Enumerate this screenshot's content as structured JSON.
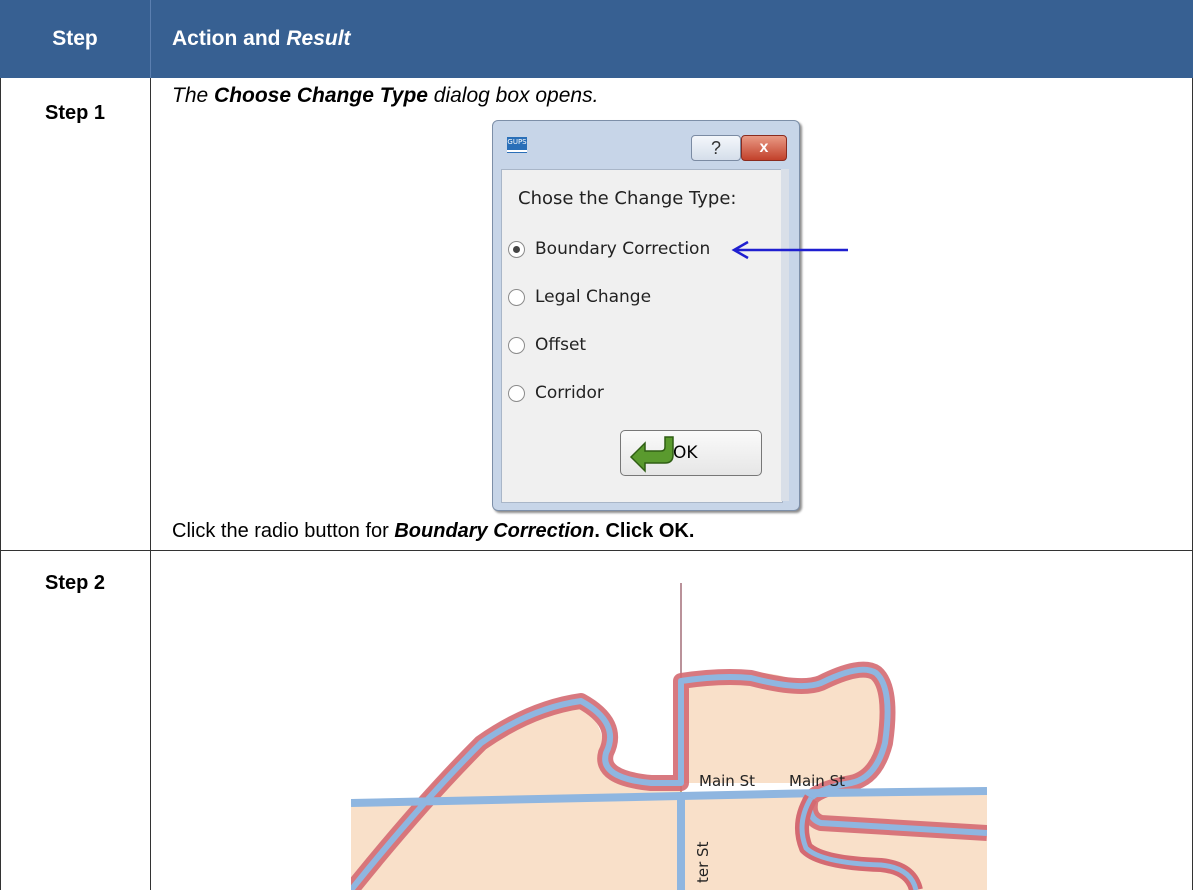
{
  "header": {
    "step": "Step",
    "action": "Action and ",
    "action_italic": "Result"
  },
  "rows": [
    {
      "step": "Step 1",
      "intro_pre": "The ",
      "intro_bold": "Choose Change Type",
      "intro_post": " dialog box opens.",
      "dialog": {
        "prompt": "Chose the Change Type:",
        "options": [
          "Boundary Correction",
          "Legal Change",
          "Offset",
          "Corridor"
        ],
        "selected": "Boundary Correction",
        "help": "?",
        "close": "x",
        "ok": "OK",
        "logo": "GUPS"
      },
      "instr_pre": "Click the radio button for ",
      "instr_bold": "Boundary Correction",
      "instr_post": ". Click OK."
    },
    {
      "step": "Step 2",
      "map_labels": [
        "Main St",
        "Main St",
        "ter St"
      ]
    }
  ],
  "colors": {
    "header_bg": "#376092",
    "arrow": "#1f1fd0",
    "boundary": "#d46a72",
    "road": "#8fb6e0",
    "land": "#f9e0c9"
  }
}
